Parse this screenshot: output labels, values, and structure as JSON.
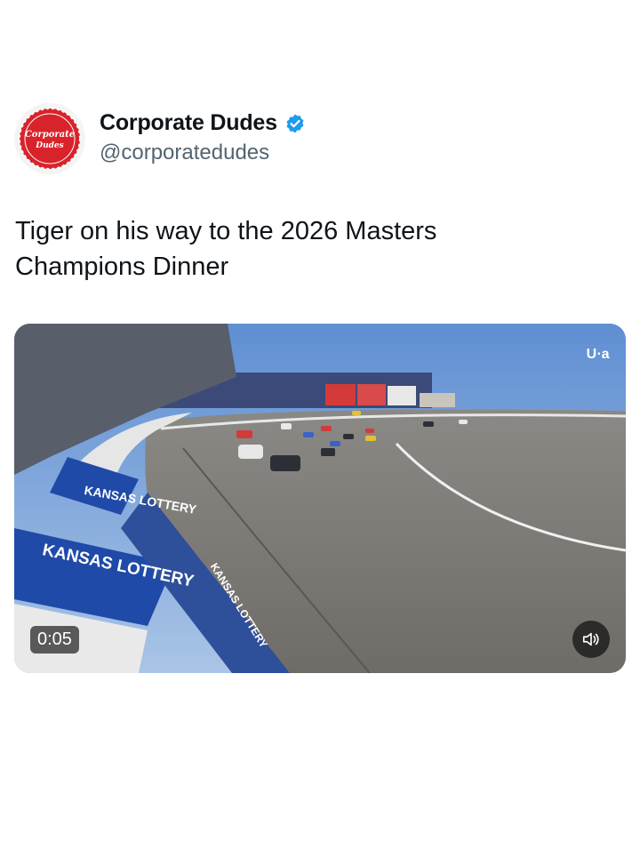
{
  "author": {
    "name": "Corporate Dudes",
    "handle": "@corporatedudes",
    "avatar_text": "Corporate Dudes",
    "verified": true,
    "verified_icon": "verified-badge-icon"
  },
  "tweet": {
    "text": "Tiger on his way to the 2026 Masters\nChampions Dinner"
  },
  "video": {
    "duration": "0:05",
    "volume_icon": "speaker-icon",
    "network_logo": "U∙a",
    "sponsor_signs": [
      "KANSAS LOTTERY",
      "KANSAS LOTTERY",
      "KANSAS LOTTERY"
    ]
  },
  "colors": {
    "accent_verified": "#1d9bf0",
    "avatar_red": "#d8232a",
    "text_primary": "#0f1419",
    "text_secondary": "#536471"
  }
}
